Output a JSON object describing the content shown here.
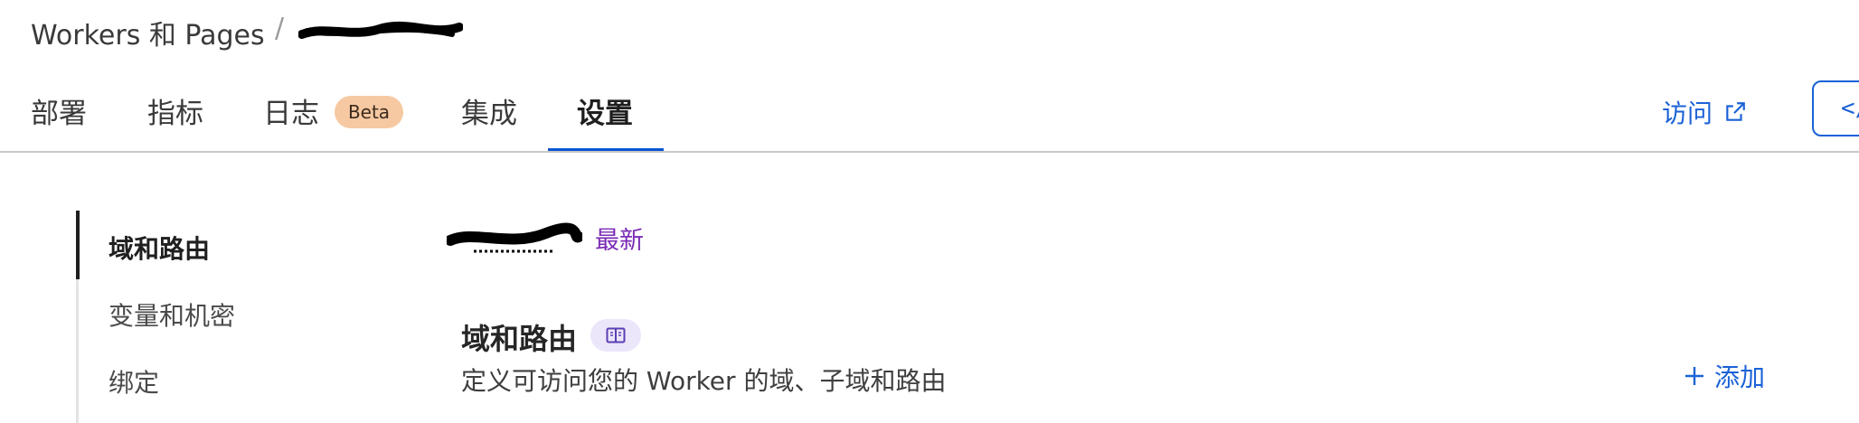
{
  "breadcrumb": {
    "root": "Workers 和 Pages",
    "separator": "/"
  },
  "tabs": [
    {
      "label": "部署"
    },
    {
      "label": "指标"
    },
    {
      "label": "日志",
      "badge": "Beta"
    },
    {
      "label": "集成"
    },
    {
      "label": "设置",
      "active": true
    }
  ],
  "header_actions": {
    "visit_label": "访问",
    "code_button_glyph": "</"
  },
  "sidenav": {
    "items": [
      {
        "label": "域和路由",
        "active": true
      },
      {
        "label": "变量和机密"
      },
      {
        "label": "绑定"
      }
    ]
  },
  "version": {
    "latest_label": "最新"
  },
  "section": {
    "title": "域和路由",
    "description": "定义可访问您的 Worker 的域、子域和路由",
    "add_label": "添加"
  },
  "colors": {
    "accent": "#1a62d6",
    "tab_underline": "#0a55d2",
    "badge_bg": "#f6c9a2",
    "latest": "#7b2bb5",
    "doc_chip_bg": "#ece6fb"
  },
  "icons": [
    "external-link-icon",
    "code-icon",
    "book-icon",
    "plus-icon"
  ]
}
